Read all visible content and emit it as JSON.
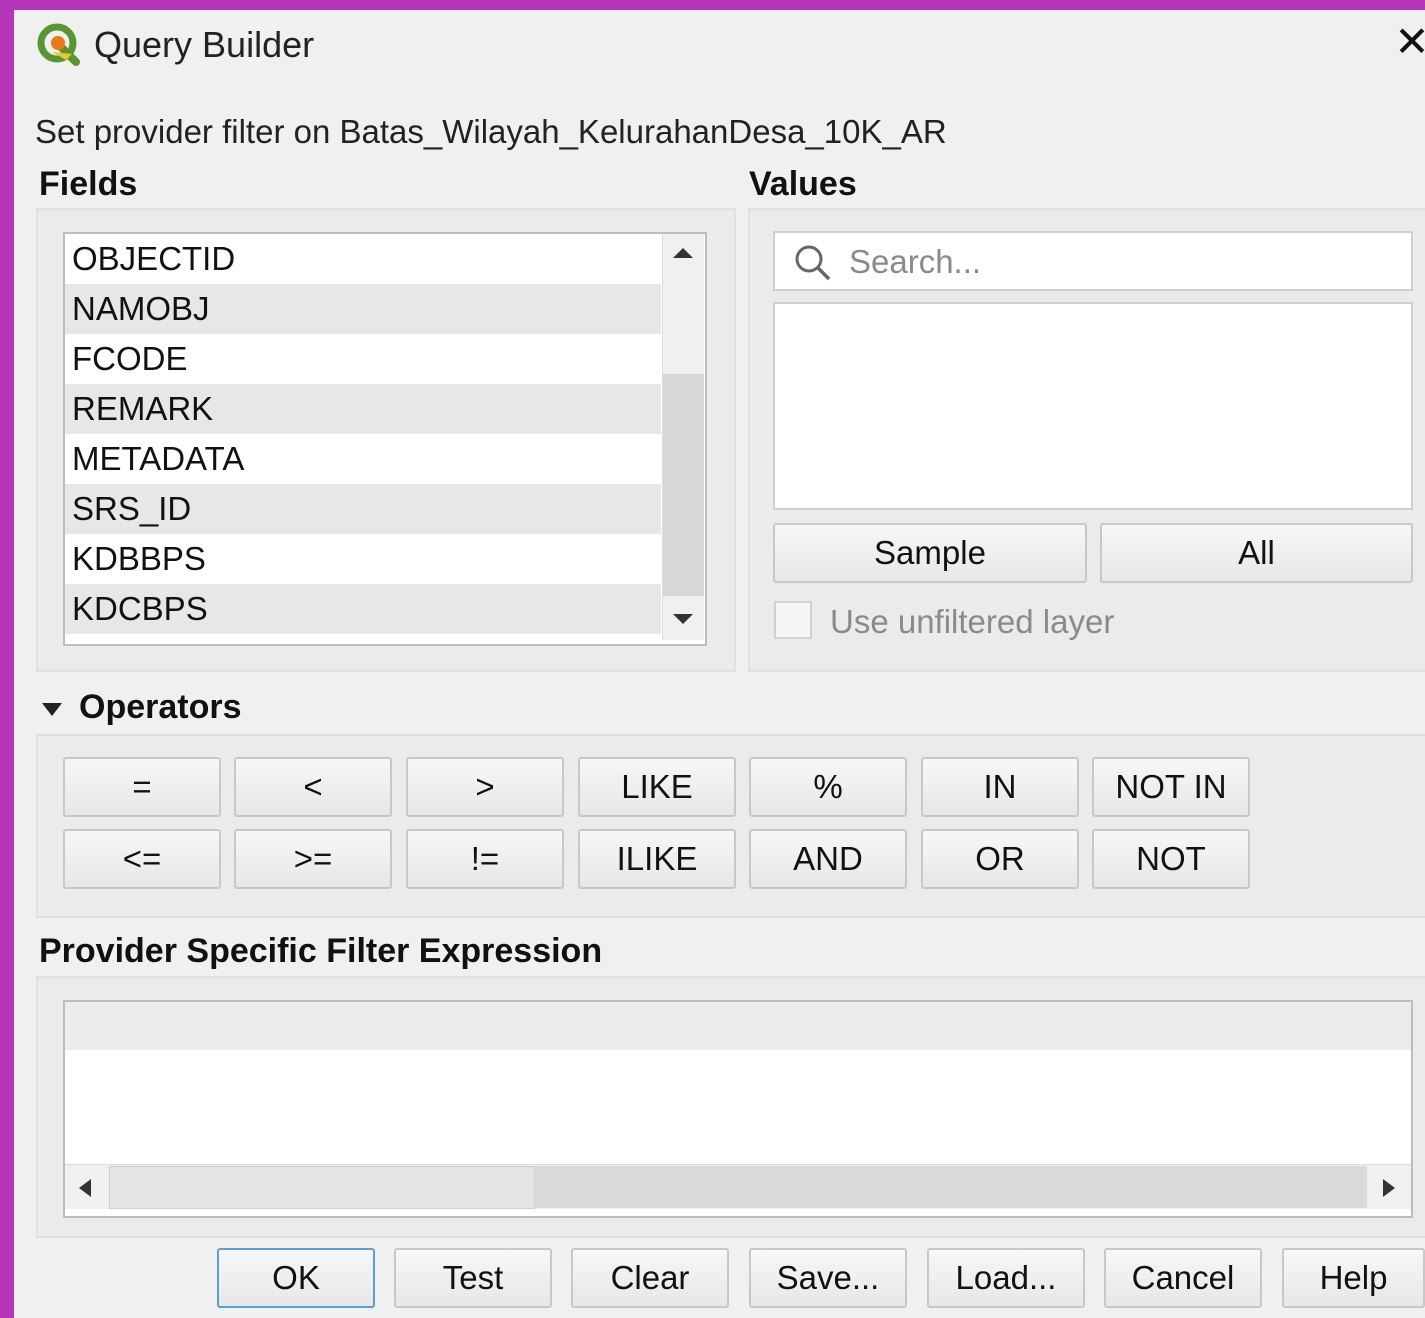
{
  "window": {
    "title": "Query Builder",
    "close_label": "✕",
    "subtitle": "Set provider filter on Batas_Wilayah_KelurahanDesa_10K_AR"
  },
  "fields": {
    "label": "Fields",
    "items": [
      "OBJECTID",
      "NAMOBJ",
      "FCODE",
      "REMARK",
      "METADATA",
      "SRS_ID",
      "KDBBPS",
      "KDCBPS"
    ]
  },
  "values": {
    "label": "Values",
    "search_placeholder": "Search...",
    "sample_label": "Sample",
    "all_label": "All",
    "unfiltered_label": "Use unfiltered layer"
  },
  "operators": {
    "label": "Operators",
    "row1": [
      "=",
      "<",
      ">",
      "LIKE",
      "%",
      "IN",
      "NOT IN"
    ],
    "row2": [
      "<=",
      ">=",
      "!=",
      "ILIKE",
      "AND",
      "OR",
      "NOT"
    ]
  },
  "expression": {
    "label": "Provider Specific Filter Expression",
    "value": ""
  },
  "buttons": {
    "ok": "OK",
    "test": "Test",
    "clear": "Clear",
    "save": "Save...",
    "load": "Load...",
    "cancel": "Cancel",
    "help": "Help"
  }
}
